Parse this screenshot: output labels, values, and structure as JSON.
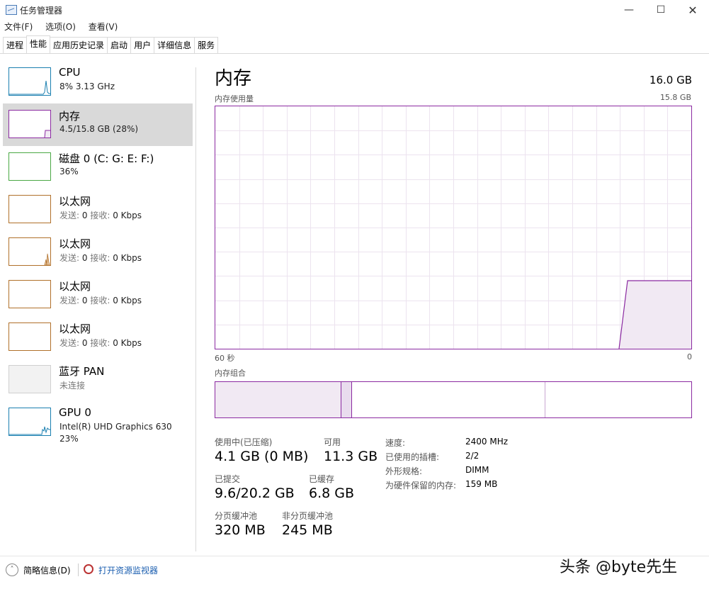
{
  "window": {
    "title": "任务管理器"
  },
  "menu": [
    "文件(F)",
    "选项(O)",
    "查看(V)"
  ],
  "tabs": [
    "进程",
    "性能",
    "应用历史记录",
    "启动",
    "用户",
    "详细信息",
    "服务"
  ],
  "sidebar": [
    {
      "title": "CPU",
      "sub": "8% 3.13 GHz",
      "color": "#1a7fb0"
    },
    {
      "title": "内存",
      "sub": "4.5/15.8 GB (28%)",
      "color": "#8b2aa1"
    },
    {
      "title": "磁盘 0 (C: G: E: F:)",
      "sub": "36%",
      "color": "#4aa844"
    },
    {
      "title": "以太网",
      "sub_a": "发送:",
      "sub_b": "0",
      "sub_c": "接收:",
      "sub_d": "0 Kbps",
      "color": "#b0702a"
    },
    {
      "title": "以太网",
      "sub_a": "发送:",
      "sub_b": "0",
      "sub_c": "接收:",
      "sub_d": "0 Kbps",
      "color": "#b0702a"
    },
    {
      "title": "以太网",
      "sub_a": "发送:",
      "sub_b": "0",
      "sub_c": "接收:",
      "sub_d": "0 Kbps",
      "color": "#b0702a"
    },
    {
      "title": "以太网",
      "sub_a": "发送:",
      "sub_b": "0",
      "sub_c": "接收:",
      "sub_d": "0 Kbps",
      "color": "#b0702a"
    },
    {
      "title": "蓝牙 PAN",
      "sub": "未连接",
      "color": "#cccccc"
    },
    {
      "title": "GPU 0",
      "sub": "Intel(R) UHD Graphics 630",
      "sub2": "23%",
      "color": "#1a7fb0"
    }
  ],
  "main": {
    "title": "内存",
    "capacity": "16.0 GB",
    "usage_label": "内存使用量",
    "usage_max": "15.8 GB",
    "time_left": "60 秒",
    "time_right": "0",
    "composition_label": "内存组合",
    "stats": {
      "in_use_label": "使用中(已压缩)",
      "in_use": "4.1 GB (0 MB)",
      "available_label": "可用",
      "available": "11.3 GB",
      "committed_label": "已提交",
      "committed": "9.6/20.2 GB",
      "cached_label": "已缓存",
      "cached": "6.8 GB",
      "paged_label": "分页缓冲池",
      "paged": "320 MB",
      "nonpaged_label": "非分页缓冲池",
      "nonpaged": "245 MB"
    },
    "specs": [
      {
        "k": "速度:",
        "v": "2400 MHz"
      },
      {
        "k": "已使用的插槽:",
        "v": "2/2"
      },
      {
        "k": "外形规格:",
        "v": "DIMM"
      },
      {
        "k": "为硬件保留的内存:",
        "v": "159 MB"
      }
    ]
  },
  "footer": {
    "brief": "简略信息(D)",
    "monitor": "打开资源监视器"
  },
  "watermark": "头条 @byte先生"
}
